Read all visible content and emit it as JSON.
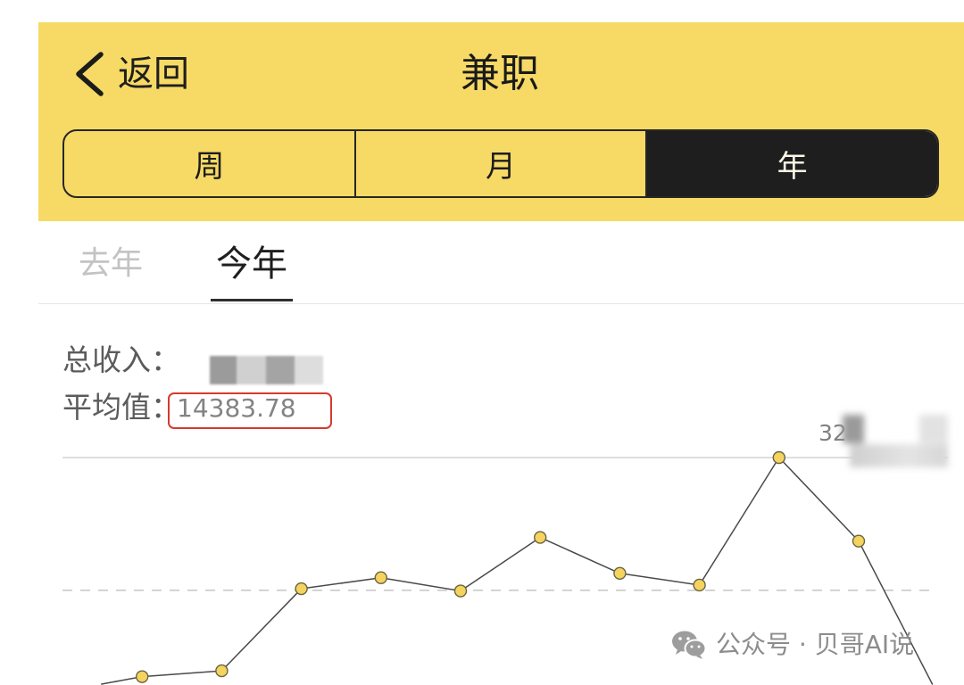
{
  "header": {
    "back_icon": "chevron-left-icon",
    "back_label": "返回",
    "title": "兼职",
    "segments": [
      {
        "label": "周",
        "selected": false
      },
      {
        "label": "月",
        "selected": false
      },
      {
        "label": "年",
        "selected": true
      }
    ]
  },
  "year_tabs": [
    {
      "label": "去年",
      "selected": false
    },
    {
      "label": "今年",
      "selected": true
    }
  ],
  "summary": {
    "total_label": "总收入：",
    "average_label": "平均值：",
    "average_value": "14383.78"
  },
  "chart_data": {
    "type": "line",
    "values": [
      600,
      2600,
      3400,
      14600,
      16100,
      14300,
      21600,
      16700,
      15100,
      32500,
      21100,
      0
    ],
    "ylim": [
      0,
      32500
    ],
    "average": 14383.78,
    "max_label": "32"
  },
  "watermark": {
    "icon": "wechat-icon",
    "text": "公众号 · 贝哥AI说"
  },
  "colors": {
    "header_bg": "#F6DA65",
    "selected_segment_bg": "#1E1E1E",
    "highlight_border": "#D63A2F",
    "marker_fill": "#F4D45E",
    "line": "#4A4A4A"
  }
}
